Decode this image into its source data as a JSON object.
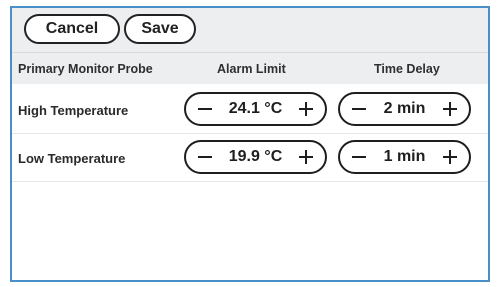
{
  "toolbar": {
    "cancel_label": "Cancel",
    "save_label": "Save"
  },
  "table": {
    "headers": {
      "probe": "Primary Monitor Probe",
      "alarm_limit": "Alarm Limit",
      "time_delay": "Time Delay"
    },
    "rows": [
      {
        "label": "High Temperature",
        "alarm_limit": "24.1 °C",
        "time_delay": "2 min"
      },
      {
        "label": "Low Temperature",
        "alarm_limit": "19.9 °C",
        "time_delay": "1 min"
      }
    ]
  },
  "icons": {
    "decrement": "minus-icon",
    "increment": "plus-icon"
  },
  "colors": {
    "frame_border": "#4a8fc9",
    "toolbar_bg": "#eceef0",
    "text": "#222222"
  }
}
